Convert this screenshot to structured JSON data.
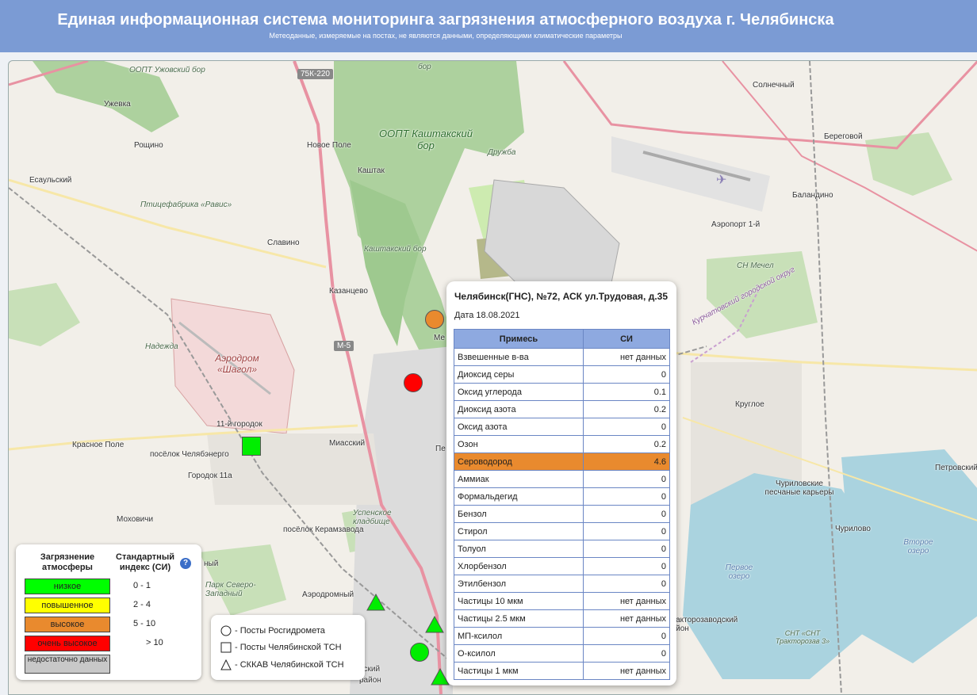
{
  "header": {
    "title": "Единая информационная система мониторинга загрязнения атмосферного воздуха г. Челябинска",
    "subtitle": "Метеоданные, измеряемые на постах, не являются данными, определяющими климатические параметры"
  },
  "colors": {
    "header_bg": "#7b9bd4",
    "low": "#00ff00",
    "elevated": "#ffff00",
    "high": "#e98a2e",
    "very_high": "#ff0000",
    "no_data": "#c8c8c8",
    "table_header": "#8ea9e0"
  },
  "map": {
    "labels": {
      "ozp_uzhovsky": "ООПТ Ужовский бор",
      "uzhevka": "Ужевка",
      "roshchino": "Рощино",
      "esaulsky": "Есаульский",
      "ptitsefabrika": "Птицефабрика «Равис»",
      "slavino": "Славино",
      "novoe_pole": "Новое Поле",
      "kashtak": "Каштак",
      "ozp_kashtaksky": "ООПТ Каштакский бор",
      "druzhba": "Дружба",
      "kashtaksky_bor": "Каштакский бор",
      "bor": "бор",
      "solnechny": "Солнечный",
      "beregovoy": "Береговой",
      "balandino": "Баландино",
      "airport": "Аэропорт 1-й",
      "sn_mechel": "СН Мечел",
      "kazantsevo": "Казанцево",
      "nadezhda": "Надежда",
      "aerodrom_shagol": "Аэродром «Шагол»",
      "gorodok_11": "11-й городок",
      "krasnoe_pole": "Красное Поле",
      "poselok_chelyabenergo": "посёлок Челябэнерго",
      "gorodok_11a": "Городок 11а",
      "miassky": "Миасский",
      "mokhovichi": "Моховичи",
      "uspenskoe": "Успенское кладбище",
      "keramzavoda": "посёлок Керамзавода",
      "park": "Парк Северо-Западный",
      "aerodromny": "Аэродромный",
      "kurchatovsky": "Курчатовский городской округ",
      "krugloe": "Круглое",
      "churilovskie": "Чуриловские песчаные карьеры",
      "petrovsky": "Петровский",
      "churilovo": "Чурилово",
      "vtoroe_ozero": "Второе озеро",
      "pervoe_ozero": "Первое озеро",
      "traktorozavodsky": "Тракторозаводский район",
      "snt": "СНТ «СНТ Тракторозав 3»",
      "me": "Ме",
      "pe": "Пе",
      "ny": "ный",
      "yskiy": "нский",
      "rayon": "район"
    },
    "road_labels": {
      "r75k": "75К-220",
      "m5": "М-5"
    }
  },
  "popup": {
    "title": "Челябинск(ГНС), №72, АСК ул.Трудовая, д.35",
    "date": "Дата 18.08.2021",
    "col_substance": "Примесь",
    "col_si": "СИ",
    "rows": [
      {
        "name": "Взвешенные в-ва",
        "value": "нет данных"
      },
      {
        "name": "Диоксид серы",
        "value": "0"
      },
      {
        "name": "Оксид углерода",
        "value": "0.1"
      },
      {
        "name": "Диоксид азота",
        "value": "0.2"
      },
      {
        "name": "Оксид азота",
        "value": "0"
      },
      {
        "name": "Озон",
        "value": "0.2"
      },
      {
        "name": "Сероводород",
        "value": "4.6",
        "highlight": true
      },
      {
        "name": "Аммиак",
        "value": "0"
      },
      {
        "name": "Формальдегид",
        "value": "0"
      },
      {
        "name": "Бензол",
        "value": "0"
      },
      {
        "name": "Стирол",
        "value": "0"
      },
      {
        "name": "Толуол",
        "value": "0"
      },
      {
        "name": "Хлорбензол",
        "value": "0"
      },
      {
        "name": "Этилбензол",
        "value": "0"
      },
      {
        "name": "Частицы 10 мкм",
        "value": "нет данных"
      },
      {
        "name": "Частицы 2.5 мкм",
        "value": "нет данных"
      },
      {
        "name": "МП-ксилол",
        "value": "0"
      },
      {
        "name": "О-ксилол",
        "value": "0"
      },
      {
        "name": "Частицы 1 мкм",
        "value": "нет данных"
      }
    ]
  },
  "legend": {
    "col1": "Загрязнение атмосферы",
    "col2": "Стандартный индекс (СИ)",
    "levels": [
      {
        "label": "низкое",
        "range": "0 - 1"
      },
      {
        "label": "повышенное",
        "range": "2 - 4"
      },
      {
        "label": "высокое",
        "range": "5 - 10"
      },
      {
        "label": "очень высокое",
        "range": "> 10"
      },
      {
        "label": "недостаточно данных",
        "range": ""
      }
    ]
  },
  "posts_legend": {
    "rosgidromet": "- Посты Росгидромета",
    "tsn": "- Посты Челябинской ТСН",
    "skkav": "- СККАВ Челябинской ТСН"
  }
}
